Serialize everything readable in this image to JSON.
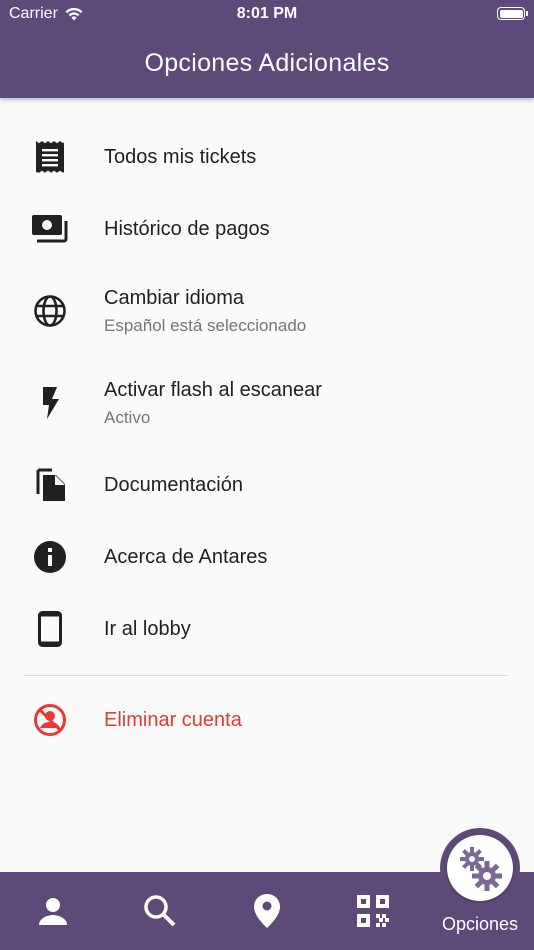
{
  "status_bar": {
    "carrier": "Carrier",
    "time": "8:01 PM"
  },
  "app_bar": {
    "title": "Opciones Adicionales"
  },
  "menu": {
    "items": [
      {
        "label": "Todos mis tickets",
        "icon": "receipt-icon"
      },
      {
        "label": "Histórico de pagos",
        "icon": "payments-icon"
      },
      {
        "label": "Cambiar idioma",
        "subtitle": "Español está seleccionado",
        "icon": "globe-icon"
      },
      {
        "label": "Activar flash al escanear",
        "subtitle": "Activo",
        "icon": "flash-icon"
      },
      {
        "label": "Documentación",
        "icon": "file-copy-icon"
      },
      {
        "label": "Acerca de Antares",
        "icon": "info-icon"
      },
      {
        "label": "Ir al lobby",
        "icon": "smartphone-icon"
      }
    ],
    "delete_account": {
      "label": "Eliminar cuenta",
      "icon": "no-account-icon"
    }
  },
  "bottom_nav": {
    "items": [
      {
        "icon": "person-icon"
      },
      {
        "icon": "search-icon"
      },
      {
        "icon": "location-pin-icon"
      },
      {
        "icon": "qr-code-icon"
      }
    ],
    "active": {
      "label": "Opciones",
      "icon": "settings-gears-icon"
    }
  },
  "colors": {
    "primary": "#5e4a78",
    "danger": "#e53935",
    "background": "#fafafa",
    "icon": "#212121"
  }
}
